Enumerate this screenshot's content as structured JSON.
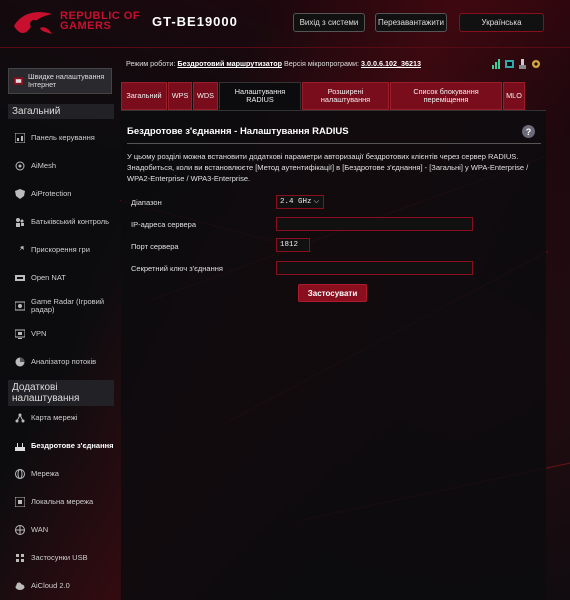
{
  "header": {
    "brand_line1": "REPUBLIC OF",
    "brand_line2": "GAMERS",
    "model": "GT-BE19000",
    "logout_label": "Вихід з системи",
    "reboot_label": "Перезавантажити",
    "language": "Українська"
  },
  "status": {
    "mode_label": "Режим роботи:",
    "mode_value": "Бездротовий маршрутизатор",
    "firmware_label": "Версія мікропрограми:",
    "firmware_value": "3.0.0.6.102_36213"
  },
  "sidebar": {
    "quick_setup": "Швидке налаштування Інтернет",
    "general_title": "Загальний",
    "general_items": [
      {
        "label": "Панель керування",
        "icon": "dashboard-icon"
      },
      {
        "label": "AiMesh",
        "icon": "aimesh-icon"
      },
      {
        "label": "AiProtection",
        "icon": "shield-icon"
      },
      {
        "label": "Батьківський контроль",
        "icon": "parental-icon"
      },
      {
        "label": "Прискорення гри",
        "icon": "rocket-icon"
      },
      {
        "label": "Open NAT",
        "icon": "nat-icon"
      },
      {
        "label": "Game Radar (Ігровий радар)",
        "icon": "radar-icon"
      },
      {
        "label": "VPN",
        "icon": "vpn-icon"
      },
      {
        "label": "Аналізатор потоків",
        "icon": "traffic-icon"
      }
    ],
    "advanced_title": "Додаткові налаштування",
    "advanced_items": [
      {
        "label": "Карта мережі",
        "icon": "network-map-icon"
      },
      {
        "label": "Бездротове з'єднання",
        "icon": "wireless-icon"
      },
      {
        "label": "Мережа",
        "icon": "globe-icon"
      },
      {
        "label": "Локальна мережа",
        "icon": "lan-icon"
      },
      {
        "label": "WAN",
        "icon": "wan-icon"
      },
      {
        "label": "Застосунки USB",
        "icon": "usb-icon"
      },
      {
        "label": "AiCloud 2.0",
        "icon": "cloud-icon"
      }
    ]
  },
  "tabs": [
    {
      "label": "Загальний"
    },
    {
      "label": "WPS"
    },
    {
      "label": "WDS"
    },
    {
      "label": "Налаштування RADIUS"
    },
    {
      "label": "Розширені налаштування"
    },
    {
      "label": "Список блокування переміщення"
    },
    {
      "label": "MLO"
    }
  ],
  "panel": {
    "title": "Бездротове з'єднання - Налаштування RADIUS",
    "description": "У цьому розділі можна встановити додаткові параметри авторизації бездротових клієнтів через сервер RADIUS. Знадобиться, коли ви встановлюєте [Метод аутентифікації] в [Бездротове з'єднання] - [Загальні] у WPA-Enterprise / WPA2-Enterprise / WPA3-Enterprise.",
    "band_label": "Діапазон",
    "band_value": "2.4 GHz",
    "server_ip_label": "IP-адреса сервера",
    "server_ip_value": "",
    "server_port_label": "Порт сервера",
    "server_port_value": "1812",
    "secret_label": "Секретний ключ з'єднання",
    "secret_value": "",
    "apply_label": "Застосувати"
  }
}
